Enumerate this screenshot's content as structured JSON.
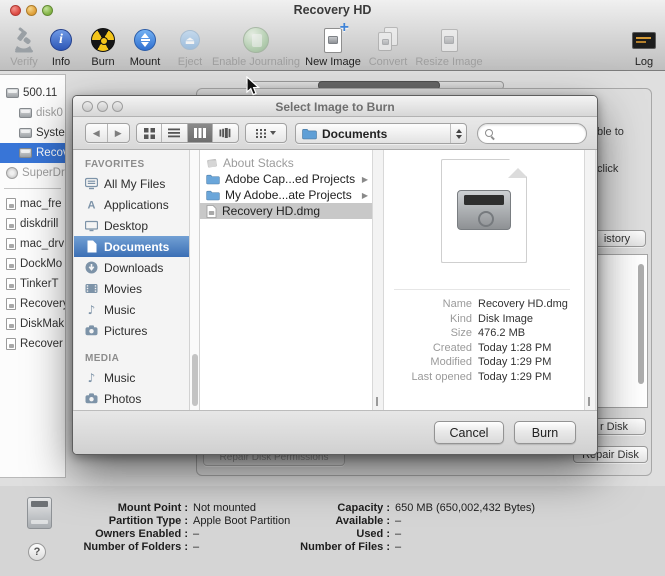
{
  "window": {
    "title": "Recovery HD",
    "toolbar": [
      {
        "label": "Verify"
      },
      {
        "label": "Info"
      },
      {
        "label": "Burn"
      },
      {
        "label": "Mount"
      },
      {
        "label": "Eject"
      },
      {
        "label": "Enable Journaling"
      },
      {
        "label": "New Image"
      },
      {
        "label": "Convert"
      },
      {
        "label": "Resize Image"
      },
      {
        "label": "Log"
      }
    ]
  },
  "device_sidebar": {
    "items": [
      {
        "label": "500.11"
      },
      {
        "label": "disk0"
      },
      {
        "label": "Syste"
      },
      {
        "label": "Recov"
      },
      {
        "label": "SuperDr"
      }
    ],
    "images": [
      {
        "label": "mac_fre"
      },
      {
        "label": "diskdrill"
      },
      {
        "label": "mac_drv"
      },
      {
        "label": "DockMo"
      },
      {
        "label": "TinkerT"
      },
      {
        "label": "Recovery"
      },
      {
        "label": "DiskMak"
      },
      {
        "label": "Recover"
      }
    ]
  },
  "background": {
    "fragment_able_to": "ble to",
    "fragment_click": "click",
    "history_button": "istory",
    "verify_disk_button": "r Disk",
    "repair_disk_button": "Repair Disk",
    "repair_permissions_button": "Repair Disk Permissions"
  },
  "dialog": {
    "title": "Select Image to Burn",
    "location": "Documents",
    "favorites_header": "FAVORITES",
    "favorites": [
      {
        "label": "All My Files"
      },
      {
        "label": "Applications"
      },
      {
        "label": "Desktop"
      },
      {
        "label": "Documents"
      },
      {
        "label": "Downloads"
      },
      {
        "label": "Movies"
      },
      {
        "label": "Music"
      },
      {
        "label": "Pictures"
      }
    ],
    "media_header": "MEDIA",
    "media": [
      {
        "label": "Music"
      },
      {
        "label": "Photos"
      }
    ],
    "files": [
      {
        "name": "About Stacks"
      },
      {
        "name": "Adobe Cap...ed Projects"
      },
      {
        "name": "My Adobe...ate Projects"
      },
      {
        "name": "Recovery HD.dmg"
      }
    ],
    "preview": {
      "rows": [
        {
          "label": "Name",
          "value": "Recovery HD.dmg"
        },
        {
          "label": "Kind",
          "value": "Disk Image"
        },
        {
          "label": "Size",
          "value": "476.2 MB"
        },
        {
          "label": "Created",
          "value": "Today 1:28 PM"
        },
        {
          "label": "Modified",
          "value": "Today 1:29 PM"
        },
        {
          "label": "Last opened",
          "value": "Today 1:29 PM"
        }
      ]
    },
    "cancel_label": "Cancel",
    "burn_label": "Burn"
  },
  "info_panel": {
    "left": [
      {
        "label": "Mount Point :",
        "value": "Not mounted"
      },
      {
        "label": "Partition Type :",
        "value": "Apple Boot Partition"
      },
      {
        "label": "Owners Enabled :",
        "value": "–"
      },
      {
        "label": "Number of Folders :",
        "value": "–"
      }
    ],
    "right": [
      {
        "label": "Capacity :",
        "value": "650 MB (650,002,432 Bytes)"
      },
      {
        "label": "Available :",
        "value": "–"
      },
      {
        "label": "Used :",
        "value": "–"
      },
      {
        "label": "Number of Files :",
        "value": "–"
      }
    ],
    "help_label": "?"
  },
  "icons": {
    "info": "i",
    "eject": "⏏",
    "back": "◀",
    "forward": "▶",
    "disclosure": "▶"
  },
  "colors": {
    "selection_blue": "#3875d7",
    "burn_yellow": "#f4c51b",
    "dialog_highlight_gray": "#c8c8c8"
  }
}
